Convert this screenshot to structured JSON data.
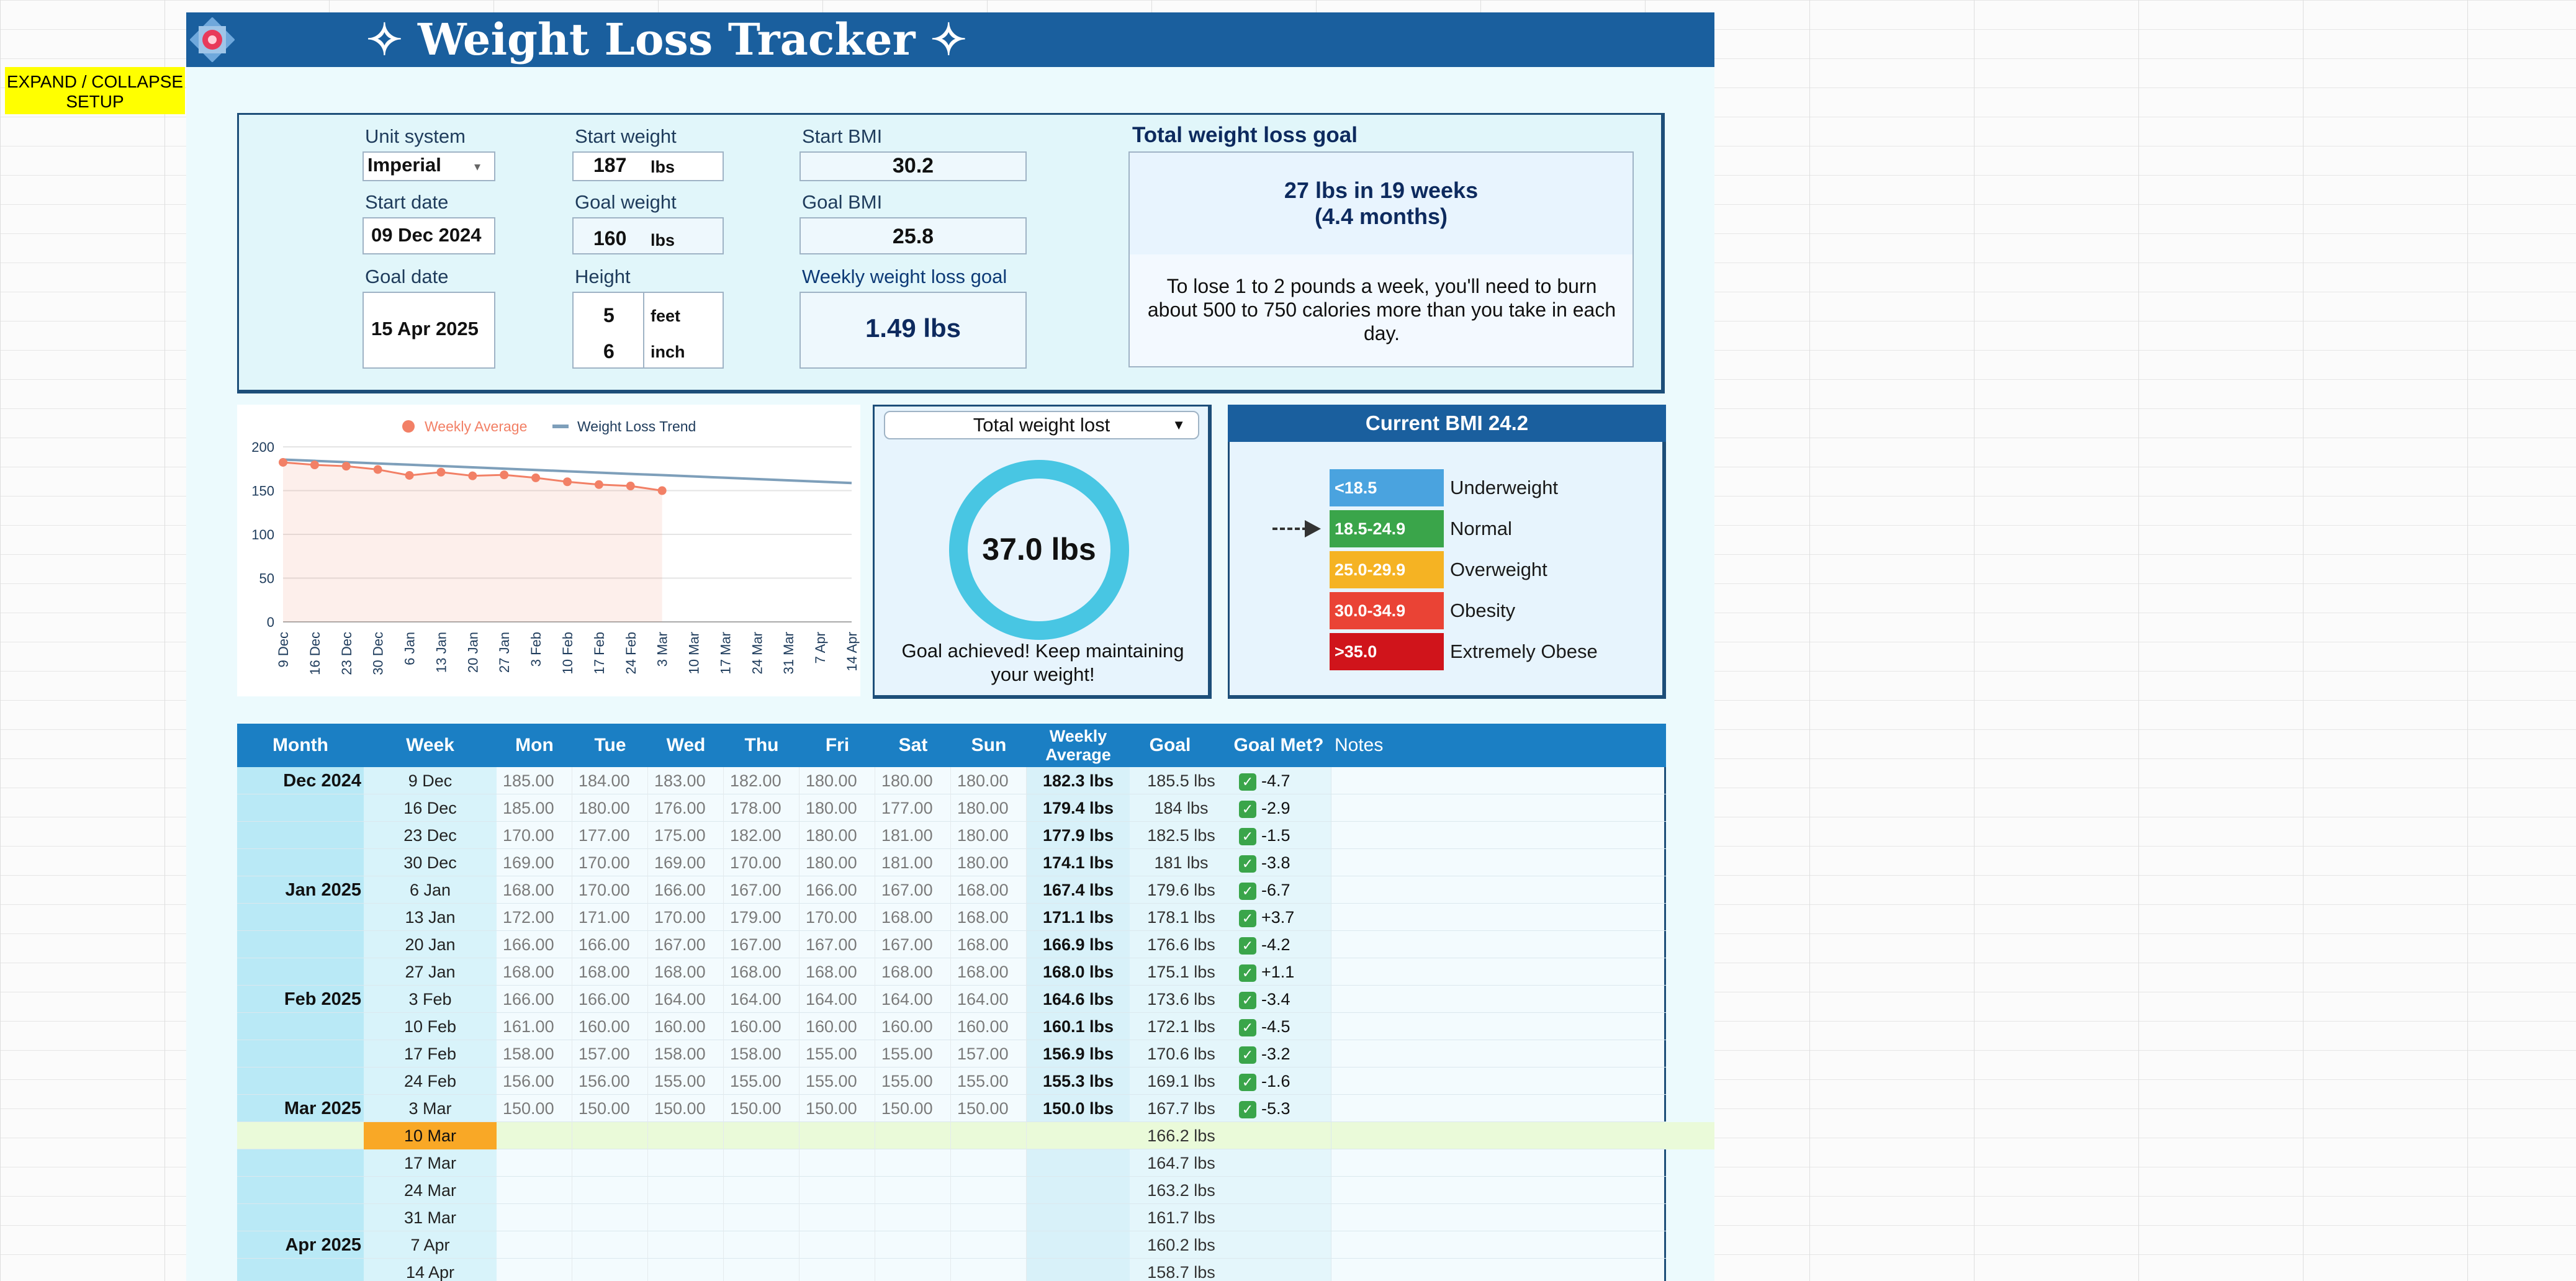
{
  "setup_toggle": "EXPAND / COLLAPSE SETUP",
  "title": "✧ Weight Loss Tracker ✧",
  "setup": {
    "unit_system_label": "Unit system",
    "unit_system": "Imperial",
    "start_date_label": "Start date",
    "start_date": "09 Dec 2024",
    "goal_date_label": "Goal date",
    "goal_date": "15 Apr 2025",
    "start_weight_label": "Start weight",
    "start_weight": "187",
    "goal_weight_label": "Goal weight",
    "goal_weight": "160",
    "weight_unit": "lbs",
    "height_label": "Height",
    "height_feet": "5",
    "height_feet_unit": "feet",
    "height_inch": "6",
    "height_inch_unit": "inch",
    "start_bmi_label": "Start BMI",
    "start_bmi": "30.2",
    "goal_bmi_label": "Goal BMI",
    "goal_bmi": "25.8",
    "weekly_goal_label": "Weekly weight loss goal",
    "weekly_goal": "1.49 lbs"
  },
  "total_goal": {
    "title": "Total weight loss goal",
    "line1": "27 lbs in 19 weeks",
    "line2": "(4.4 months)",
    "tip": "To lose 1 to 2 pounds a week, you'll need to burn about 500 to 750 calories more than you take in each day."
  },
  "progress": {
    "select": "Total weight lost",
    "value": "37.0 lbs",
    "caption": "Goal achieved! Keep maintaining your weight!",
    "fraction": 1.0
  },
  "bmi": {
    "title": "Current BMI 24.2",
    "categories": [
      {
        "range": "<18.5",
        "name": "Underweight",
        "color": "#4aa3df"
      },
      {
        "range": "18.5-24.9",
        "name": "Normal",
        "color": "#3aa54a"
      },
      {
        "range": "25.0-29.9",
        "name": "Overweight",
        "color": "#f5b323"
      },
      {
        "range": "30.0-34.9",
        "name": "Obesity",
        "color": "#ea4335"
      },
      {
        "range": ">35.0",
        "name": "Extremely Obese",
        "color": "#d0141b"
      }
    ],
    "current_index": 1
  },
  "chart_data": {
    "type": "line",
    "legend": [
      "Weekly Average",
      "Weight Loss Trend"
    ],
    "legend_position": "top",
    "x": [
      "9 Dec",
      "16 Dec",
      "23 Dec",
      "30 Dec",
      "6 Jan",
      "13 Jan",
      "20 Jan",
      "27 Jan",
      "3 Feb",
      "10 Feb",
      "17 Feb",
      "24 Feb",
      "3 Mar",
      "10 Mar",
      "17 Mar",
      "24 Mar",
      "31 Mar",
      "7 Apr",
      "14 Apr"
    ],
    "series": [
      {
        "name": "Weekly Average",
        "values": [
          182.3,
          179.4,
          177.9,
          174.1,
          167.4,
          171.1,
          166.9,
          168.0,
          164.6,
          160.1,
          156.9,
          155.3,
          150.0
        ],
        "color": "#f28066"
      },
      {
        "name": "Weight Loss Trend",
        "values": [
          185.5,
          184,
          182.5,
          181,
          179.6,
          178.1,
          176.6,
          175.1,
          173.6,
          172.1,
          170.6,
          169.1,
          167.7,
          166.2,
          164.7,
          163.2,
          161.7,
          160.2,
          158.7
        ],
        "color": "#7e9fba"
      }
    ],
    "ylim": [
      0,
      200
    ],
    "yticks": [
      0,
      50,
      100,
      150,
      200
    ],
    "grid": true
  },
  "table": {
    "headers": [
      "Month",
      "Week",
      "Mon",
      "Tue",
      "Wed",
      "Thu",
      "Fri",
      "Sat",
      "Sun",
      "Weekly Average",
      "Goal",
      "Goal Met?",
      "Notes"
    ],
    "rows": [
      {
        "month": "Dec 2024",
        "week": "9 Dec",
        "days": [
          "185.00",
          "184.00",
          "183.00",
          "182.00",
          "180.00",
          "180.00",
          "180.00"
        ],
        "avg": "182.3 lbs",
        "goal": "185.5 lbs",
        "met": "-4.7",
        "check": true
      },
      {
        "month": "",
        "week": "16 Dec",
        "days": [
          "185.00",
          "180.00",
          "176.00",
          "178.00",
          "180.00",
          "177.00",
          "180.00"
        ],
        "avg": "179.4 lbs",
        "goal": "184 lbs",
        "met": "-2.9",
        "check": true
      },
      {
        "month": "",
        "week": "23 Dec",
        "days": [
          "170.00",
          "177.00",
          "175.00",
          "182.00",
          "180.00",
          "181.00",
          "180.00"
        ],
        "avg": "177.9 lbs",
        "goal": "182.5 lbs",
        "met": "-1.5",
        "check": true
      },
      {
        "month": "",
        "week": "30 Dec",
        "days": [
          "169.00",
          "170.00",
          "169.00",
          "170.00",
          "180.00",
          "181.00",
          "180.00"
        ],
        "avg": "174.1 lbs",
        "goal": "181 lbs",
        "met": "-3.8",
        "check": true
      },
      {
        "month": "Jan 2025",
        "week": "6 Jan",
        "days": [
          "168.00",
          "170.00",
          "166.00",
          "167.00",
          "166.00",
          "167.00",
          "168.00"
        ],
        "avg": "167.4 lbs",
        "goal": "179.6 lbs",
        "met": "-6.7",
        "check": true
      },
      {
        "month": "",
        "week": "13 Jan",
        "days": [
          "172.00",
          "171.00",
          "170.00",
          "179.00",
          "170.00",
          "168.00",
          "168.00"
        ],
        "avg": "171.1 lbs",
        "goal": "178.1 lbs",
        "met": "+3.7",
        "check": true
      },
      {
        "month": "",
        "week": "20 Jan",
        "days": [
          "166.00",
          "166.00",
          "167.00",
          "167.00",
          "167.00",
          "167.00",
          "168.00"
        ],
        "avg": "166.9 lbs",
        "goal": "176.6 lbs",
        "met": "-4.2",
        "check": true
      },
      {
        "month": "",
        "week": "27 Jan",
        "days": [
          "168.00",
          "168.00",
          "168.00",
          "168.00",
          "168.00",
          "168.00",
          "168.00"
        ],
        "avg": "168.0 lbs",
        "goal": "175.1 lbs",
        "met": "+1.1",
        "check": true
      },
      {
        "month": "Feb 2025",
        "week": "3 Feb",
        "days": [
          "166.00",
          "166.00",
          "164.00",
          "164.00",
          "164.00",
          "164.00",
          "164.00"
        ],
        "avg": "164.6 lbs",
        "goal": "173.6 lbs",
        "met": "-3.4",
        "check": true
      },
      {
        "month": "",
        "week": "10 Feb",
        "days": [
          "161.00",
          "160.00",
          "160.00",
          "160.00",
          "160.00",
          "160.00",
          "160.00"
        ],
        "avg": "160.1 lbs",
        "goal": "172.1 lbs",
        "met": "-4.5",
        "check": true
      },
      {
        "month": "",
        "week": "17 Feb",
        "days": [
          "158.00",
          "157.00",
          "158.00",
          "158.00",
          "155.00",
          "155.00",
          "157.00"
        ],
        "avg": "156.9 lbs",
        "goal": "170.6 lbs",
        "met": "-3.2",
        "check": true
      },
      {
        "month": "",
        "week": "24 Feb",
        "days": [
          "156.00",
          "156.00",
          "155.00",
          "155.00",
          "155.00",
          "155.00",
          "155.00"
        ],
        "avg": "155.3 lbs",
        "goal": "169.1 lbs",
        "met": "-1.6",
        "check": true
      },
      {
        "month": "Mar 2025",
        "week": "3 Mar",
        "days": [
          "150.00",
          "150.00",
          "150.00",
          "150.00",
          "150.00",
          "150.00",
          "150.00"
        ],
        "avg": "150.0 lbs",
        "goal": "167.7 lbs",
        "met": "-5.3",
        "check": true
      },
      {
        "month": "",
        "week": "10 Mar",
        "days": [
          "",
          "",
          "",
          "",
          "",
          "",
          ""
        ],
        "avg": "",
        "goal": "166.2 lbs",
        "met": "",
        "check": false,
        "current": true
      },
      {
        "month": "",
        "week": "17 Mar",
        "days": [
          "",
          "",
          "",
          "",
          "",
          "",
          ""
        ],
        "avg": "",
        "goal": "164.7 lbs",
        "met": "",
        "check": false
      },
      {
        "month": "",
        "week": "24 Mar",
        "days": [
          "",
          "",
          "",
          "",
          "",
          "",
          ""
        ],
        "avg": "",
        "goal": "163.2 lbs",
        "met": "",
        "check": false
      },
      {
        "month": "",
        "week": "31 Mar",
        "days": [
          "",
          "",
          "",
          "",
          "",
          "",
          ""
        ],
        "avg": "",
        "goal": "161.7 lbs",
        "met": "",
        "check": false
      },
      {
        "month": "Apr 2025",
        "week": "7 Apr",
        "days": [
          "",
          "",
          "",
          "",
          "",
          "",
          ""
        ],
        "avg": "",
        "goal": "160.2 lbs",
        "met": "",
        "check": false
      },
      {
        "month": "",
        "week": "14 Apr",
        "days": [
          "",
          "",
          "",
          "",
          "",
          "",
          ""
        ],
        "avg": "",
        "goal": "158.7 lbs",
        "met": "",
        "check": false
      }
    ]
  }
}
